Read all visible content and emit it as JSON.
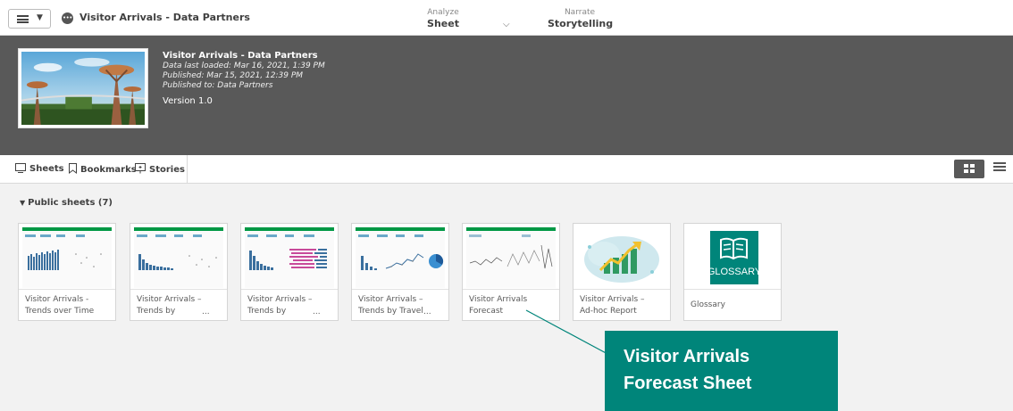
{
  "topbar": {
    "app_title": "Visitor Arrivals - Data Partners",
    "analyze_small": "Analyze",
    "analyze_value": "Sheet",
    "narrate_small": "Narrate",
    "narrate_value": "Storytelling"
  },
  "app": {
    "title": "Visitor Arrivals - Data Partners",
    "last_loaded": "Data last loaded: Mar 16, 2021, 1:39 PM",
    "published": "Published: Mar 15, 2021, 12:39 PM",
    "published_to": "Published to: Data Partners",
    "version": "Version 1.0"
  },
  "tabs": {
    "sheets": "Sheets",
    "bookmarks": "Bookmarks",
    "stories": "Stories"
  },
  "section": {
    "title": "Public sheets (7)"
  },
  "cards": [
    {
      "line1": "Visitor Arrivals -",
      "line2": "Trends over Time",
      "ellipsis": ""
    },
    {
      "line1": "Visitor Arrivals –",
      "line2": "Trends by",
      "ellipsis": "..."
    },
    {
      "line1": "Visitor Arrivals –",
      "line2": "Trends by",
      "ellipsis": "..."
    },
    {
      "line1": "Visitor Arrivals –",
      "line2": "Trends by Travel",
      "ellipsis": "..."
    },
    {
      "line1": "Visitor Arrivals",
      "line2": "Forecast",
      "ellipsis": ""
    },
    {
      "line1": "Visitor Arrivals –",
      "line2": "Ad-hoc Report",
      "ellipsis": ""
    },
    {
      "line1": "Glossary",
      "line2": "",
      "ellipsis": ""
    }
  ],
  "glossary_icon_text": "GLOSSARY",
  "callout": {
    "text": "Visitor Arrivals Forecast Sheet"
  },
  "colors": {
    "banner": "#595959",
    "accent": "#00857a",
    "sheet_green": "#009845"
  }
}
